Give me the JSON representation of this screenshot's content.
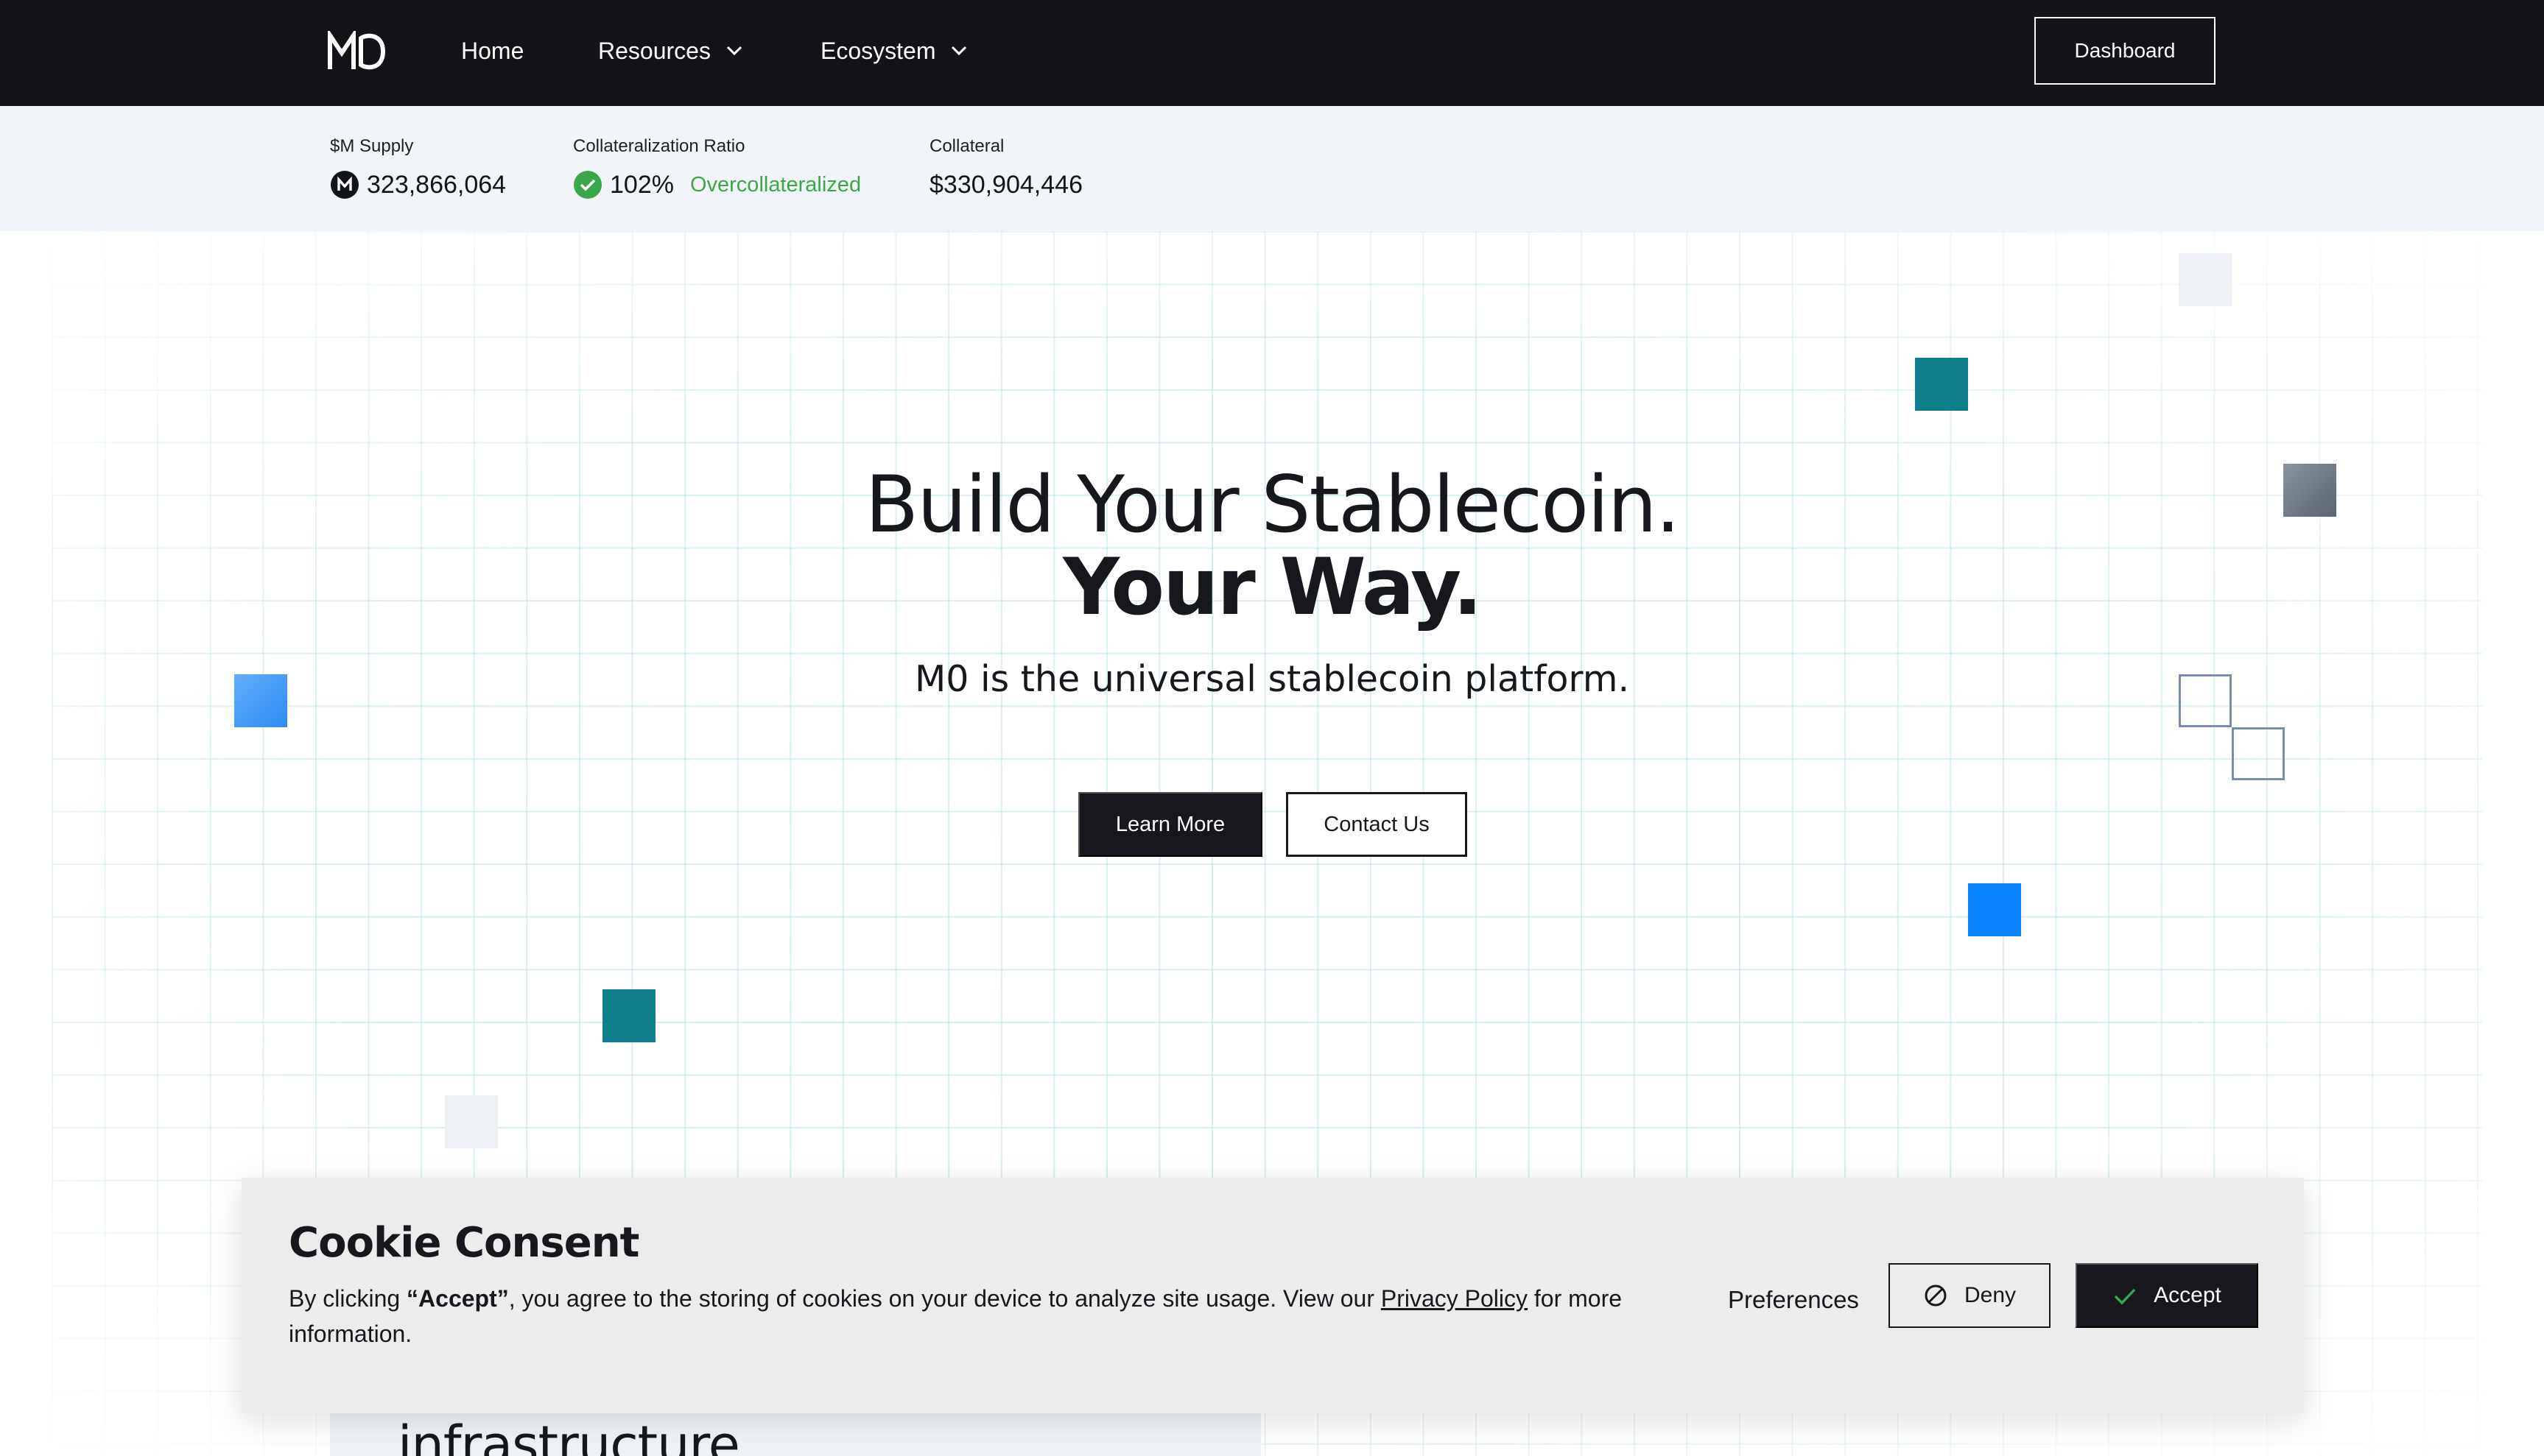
{
  "nav": {
    "logo_alt": "M0",
    "items": [
      {
        "label": "Home",
        "has_dropdown": false
      },
      {
        "label": "Resources",
        "has_dropdown": true
      },
      {
        "label": "Ecosystem",
        "has_dropdown": true
      }
    ],
    "dashboard_label": "Dashboard"
  },
  "stats": {
    "supply": {
      "label": "$M Supply",
      "value": "323,866,064",
      "icon": "m-coin-icon"
    },
    "ratio": {
      "label": "Collateralization Ratio",
      "value": "102%",
      "status": "Overcollateralized",
      "icon": "check-circle-icon",
      "status_color": "#3aa84a"
    },
    "collateral": {
      "label": "Collateral",
      "value": "$330,904,446"
    }
  },
  "hero": {
    "title_line1": "Build Your Stablecoin.",
    "title_line2": "Your Way.",
    "subtitle": "M0 is the universal stablecoin platform.",
    "learn_more": "Learn More",
    "contact_us": "Contact Us",
    "peek_heading": "infrastructure"
  },
  "cookie": {
    "title": "Cookie Consent",
    "text_before": "By clicking ",
    "text_bold": "“Accept”",
    "text_middle": ", you agree to the storing of cookies on your device to analyze site usage. View our ",
    "privacy_link": "Privacy Policy",
    "text_after": " for more information.",
    "preferences": "Preferences",
    "deny": "Deny",
    "accept": "Accept"
  },
  "colors": {
    "nav_bg": "#121418",
    "stats_bg": "#f1f5f9",
    "teal": "#0e7f8a",
    "blue": "#0a84ff",
    "gray": "#5f6a75",
    "status_green": "#3aa84a"
  }
}
